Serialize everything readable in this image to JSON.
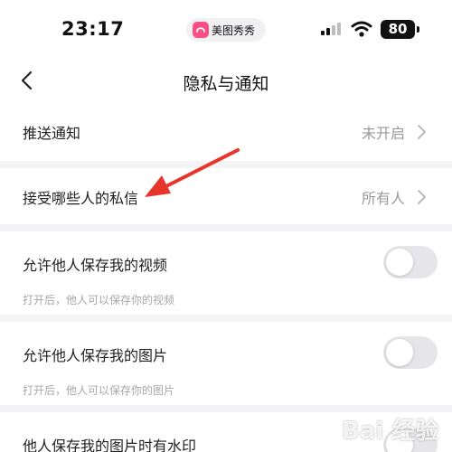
{
  "status_bar": {
    "time": "23:17",
    "app_name": "美图秀秀",
    "battery": "80",
    "brand_color": "#fb4e84"
  },
  "nav": {
    "title": "隐私与通知",
    "back_icon": "chevron-left-icon"
  },
  "rows": [
    {
      "label": "推送通知",
      "value": "未开启"
    },
    {
      "label": "接受哪些人的私信",
      "value": "所有人"
    },
    {
      "label": "允许他人保存我的视频",
      "hint": "打开后，他人可以保存你的视频",
      "toggle_on": false
    },
    {
      "label": "允许他人保存我的图片",
      "hint": "打开后，他人可以保存你的图片",
      "toggle_on": false
    },
    {
      "label": "他人保存我的图片时有水印",
      "toggle_on": false
    }
  ],
  "annotation": {
    "color": "#e8352b",
    "points_to": "接受哪些人的私信"
  },
  "watermark": {
    "text": "Bai 经验"
  }
}
